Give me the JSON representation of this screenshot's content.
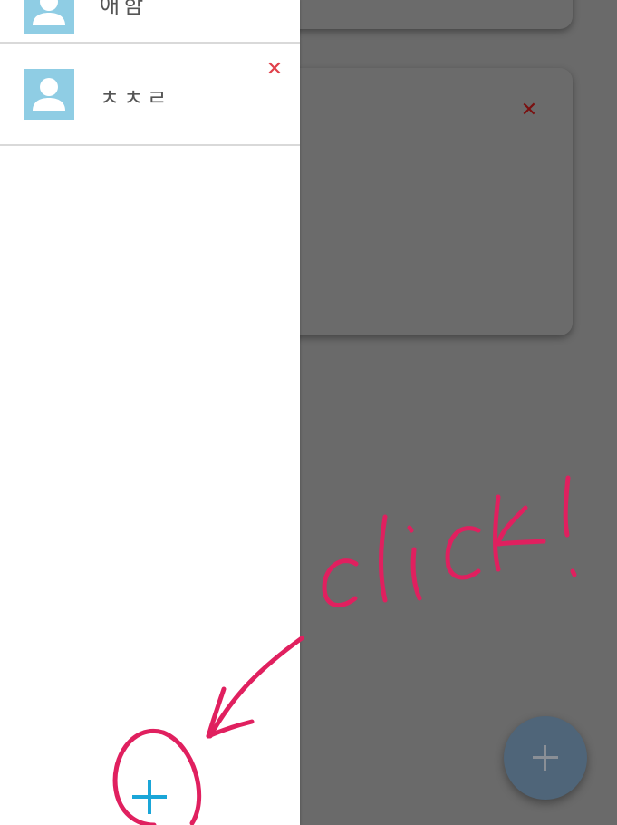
{
  "drawer": {
    "items": [
      {
        "name": "애함"
      },
      {
        "name": "ㅊㅊㄹ"
      }
    ],
    "close_glyph": "✕"
  },
  "background": {
    "card_close_glyph": "✕"
  },
  "annotation": {
    "text": "click!",
    "color": "#e0205f"
  },
  "colors": {
    "drawer_add": "#1aa6d8",
    "avatar_bg": "#8fcde4",
    "close_red": "#e0404a",
    "overlay": "#6a6a6a",
    "fab_bg": "#4f6579"
  },
  "icons": [
    "person-icon",
    "close-icon",
    "plus-icon"
  ]
}
